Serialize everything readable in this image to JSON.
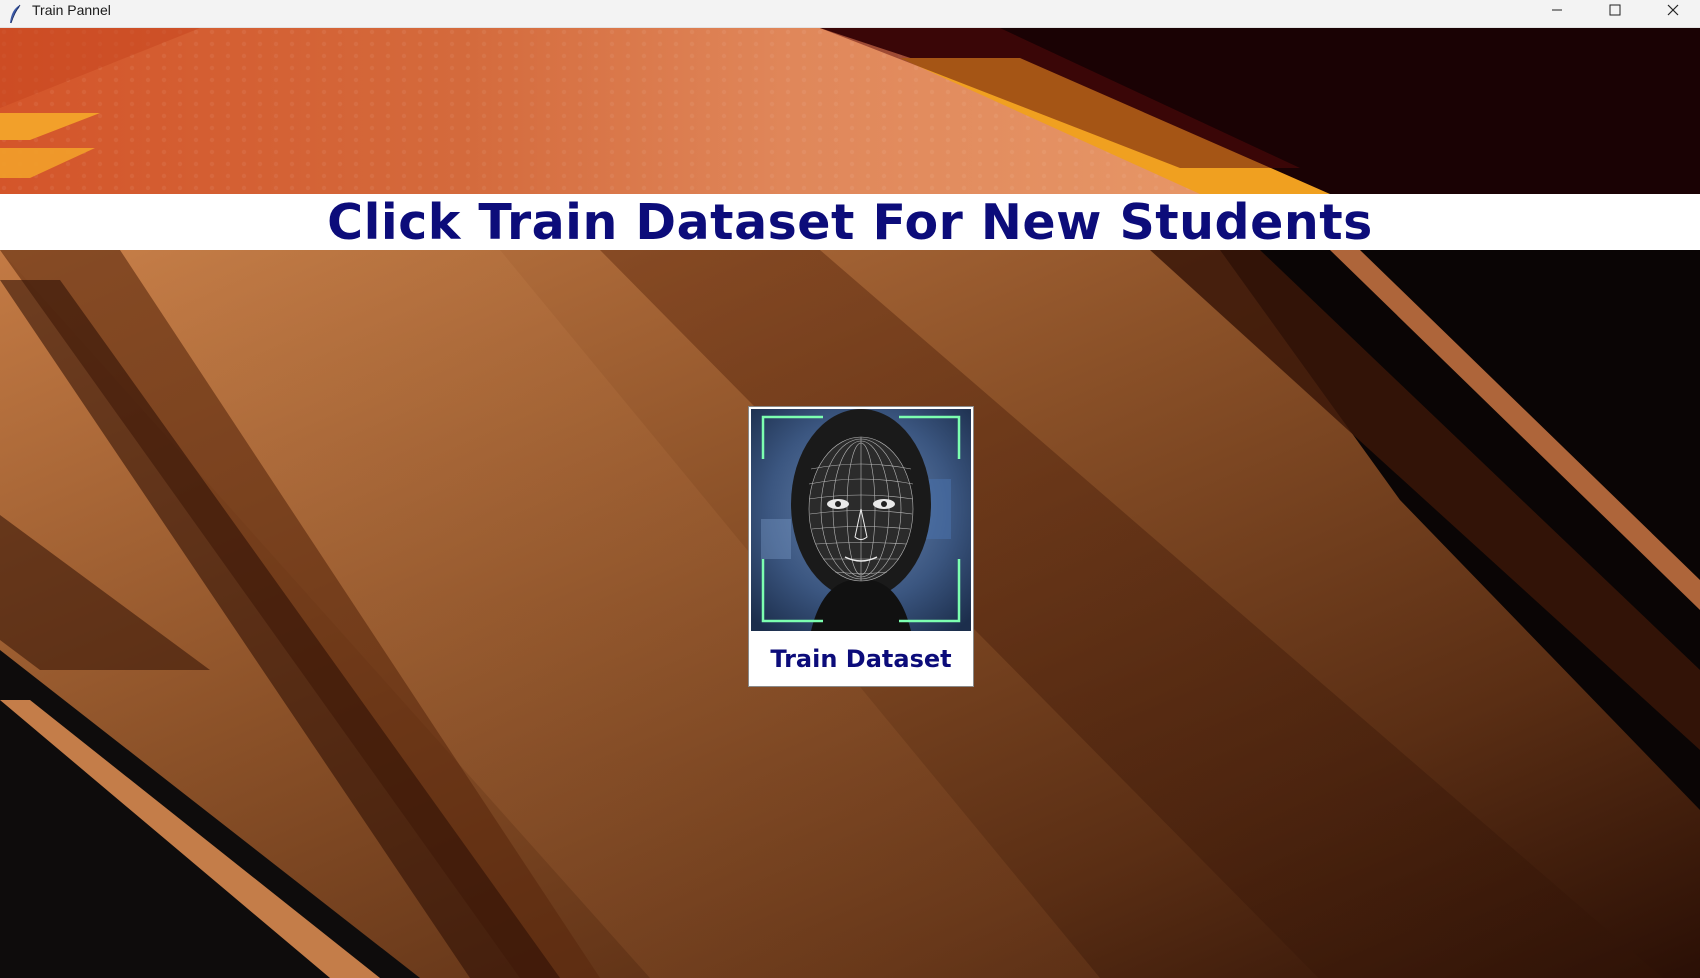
{
  "window": {
    "title": "Train Pannel",
    "controls": {
      "minimize": "minimize-icon",
      "maximize": "maximize-icon",
      "close": "close-icon"
    }
  },
  "banner": {
    "text": "Click Train Dataset For New Students",
    "color": "#0c0c7a",
    "background": "#ffffff"
  },
  "train_button": {
    "label": "Train Dataset",
    "icon": "face-mesh-scan-image"
  },
  "colors": {
    "accent_orange": "#d2733c",
    "dark_brown": "#3a1a0a",
    "scan_frame_green": "#7cffb0"
  }
}
